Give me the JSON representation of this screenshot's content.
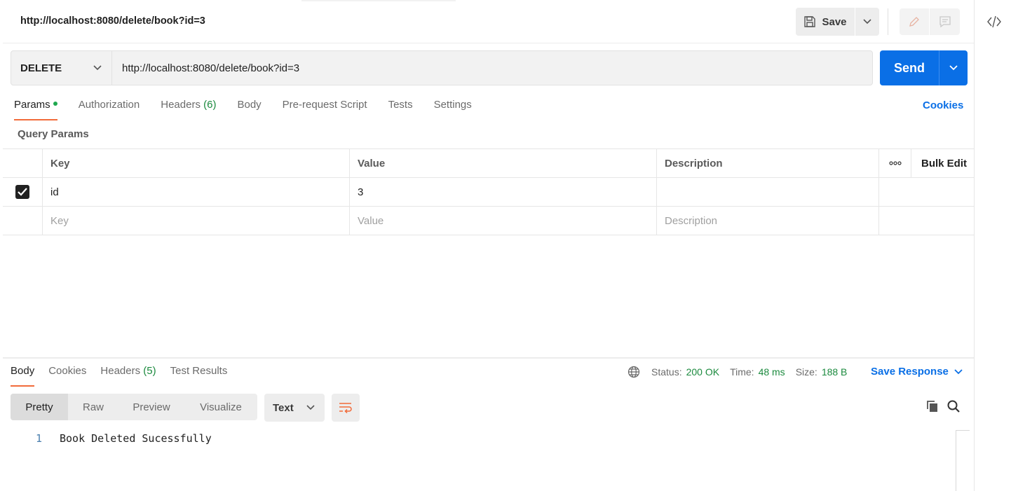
{
  "request": {
    "title": "http://localhost:8080/delete/book?id=3",
    "method": "DELETE",
    "url": "http://localhost:8080/delete/book?id=3"
  },
  "toolbar": {
    "save_label": "Save",
    "send_label": "Send"
  },
  "tabs": {
    "params": "Params",
    "authorization": "Authorization",
    "headers": "Headers",
    "headers_count": "(6)",
    "body": "Body",
    "prerequest": "Pre-request Script",
    "tests": "Tests",
    "settings": "Settings",
    "cookies": "Cookies"
  },
  "query_params": {
    "label": "Query Params",
    "columns": [
      "Key",
      "Value",
      "Description",
      "Bulk Edit"
    ],
    "rows": [
      {
        "checked": true,
        "key": "id",
        "value": "3",
        "description": ""
      }
    ],
    "placeholders": {
      "key": "Key",
      "value": "Value",
      "description": "Description"
    }
  },
  "response": {
    "tabs": {
      "body": "Body",
      "cookies": "Cookies",
      "headers": "Headers",
      "headers_count": "(5)",
      "test_results": "Test Results"
    },
    "status_label": "Status:",
    "status_value": "200 OK",
    "time_label": "Time:",
    "time_value": "48 ms",
    "size_label": "Size:",
    "size_value": "188 B",
    "save_response": "Save Response",
    "views": [
      "Pretty",
      "Raw",
      "Preview",
      "Visualize"
    ],
    "format": "Text",
    "lines": [
      {
        "n": "1",
        "text": "Book Deleted Sucessfully"
      }
    ]
  },
  "colors": {
    "accent": "#f26b3a",
    "primary": "#0a6fe6",
    "success": "#1b8a3e"
  }
}
